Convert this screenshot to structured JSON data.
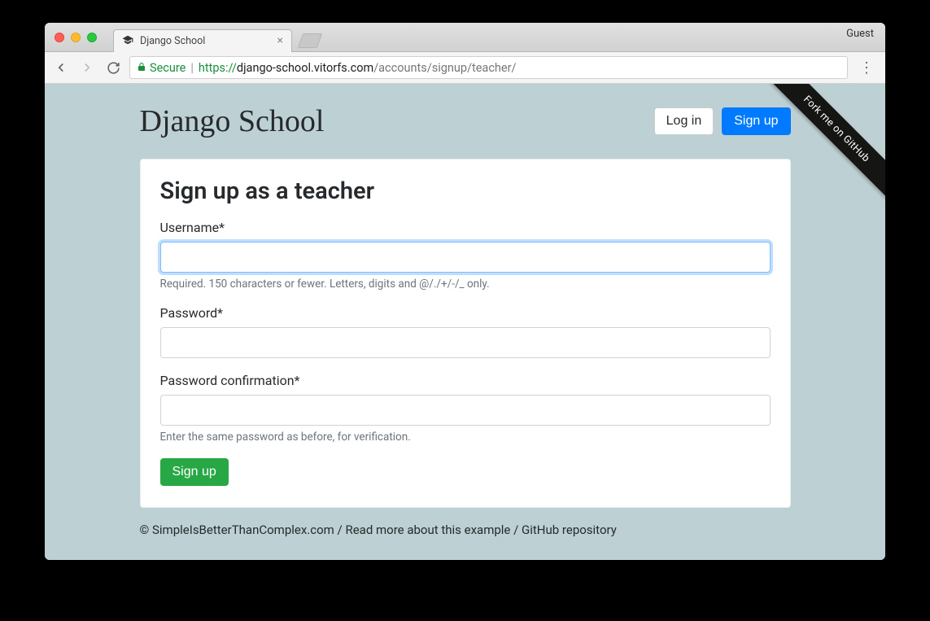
{
  "browser": {
    "tab_title": "Django School",
    "guest_label": "Guest",
    "secure_label": "Secure",
    "url_proto": "https://",
    "url_host": "django-school.vitorfs.com",
    "url_path": "/accounts/signup/teacher/"
  },
  "header": {
    "logo": "Django School",
    "login_label": "Log in",
    "signup_label": "Sign up"
  },
  "ribbon": {
    "label": "Fork me on GitHub"
  },
  "form": {
    "heading": "Sign up as a teacher",
    "username_label": "Username*",
    "username_help": "Required. 150 characters or fewer. Letters, digits and @/./+/-/_ only.",
    "password_label": "Password*",
    "password_confirm_label": "Password confirmation*",
    "password_confirm_help": "Enter the same password as before, for verification.",
    "submit_label": "Sign up"
  },
  "footer": {
    "copyright": "© SimpleIsBetterThanComplex.com",
    "sep": " / ",
    "link1": "Read more about this example",
    "link2": "GitHub repository"
  }
}
